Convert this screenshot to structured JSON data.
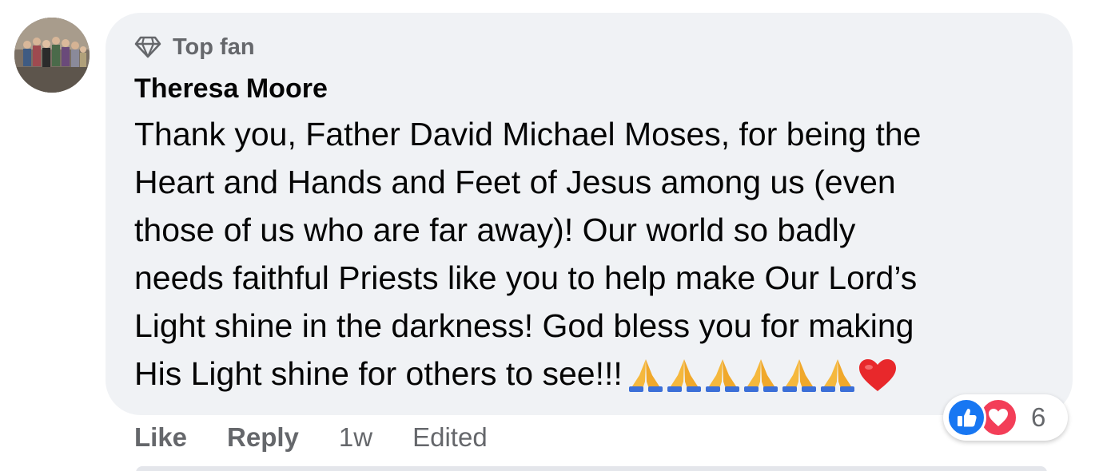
{
  "comment": {
    "badge_label": "Top fan",
    "author": "Theresa Moore",
    "lines": [
      "Thank you, Father David Michael Moses, for being the",
      "Heart and Hands and Feet of Jesus among us (even",
      "those of us who are far away)! Our world so badly",
      "needs faithful Priests like you to help make Our Lord’s",
      "Light shine in the darkness! God bless you for making",
      "His Light shine for others to see!!!"
    ],
    "emojis": [
      "🙏",
      "🙏",
      "🙏",
      "🙏",
      "🙏",
      "🙏",
      "❤️"
    ]
  },
  "actions": {
    "like_label": "Like",
    "reply_label": "Reply",
    "timestamp": "1w",
    "edited_label": "Edited"
  },
  "reactions": {
    "types": [
      "like-icon",
      "love-icon"
    ],
    "count": "6"
  },
  "colors": {
    "bubble": "#f0f2f5",
    "text": "#050505",
    "secondary_text": "#65676b",
    "like_blue": "#1877f2",
    "love_red": "#f33e58"
  }
}
